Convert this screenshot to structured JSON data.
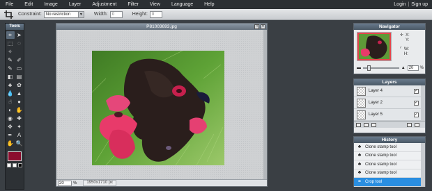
{
  "menubar": {
    "items": [
      "File",
      "Edit",
      "Image",
      "Layer",
      "Adjustment",
      "Filter",
      "View",
      "Language",
      "Help"
    ],
    "login": "Login",
    "separator": "|",
    "signup": "Sign up"
  },
  "options": {
    "constraint_label": "Constraint:",
    "constraint_value": "No restriction",
    "width_label": "Width:",
    "width_value": "0",
    "height_label": "Height:",
    "height_value": "0"
  },
  "tools": {
    "title": "Tools",
    "items": [
      {
        "icon": "crop-icon",
        "glyph": "⌗"
      },
      {
        "icon": "move-icon",
        "glyph": "➤"
      },
      {
        "icon": "marquee-icon",
        "glyph": "⬚"
      },
      {
        "icon": "lasso-icon",
        "glyph": "◌"
      },
      {
        "icon": "magic-wand-icon",
        "glyph": "✧"
      },
      {
        "icon": "blank-icon",
        "glyph": ""
      },
      {
        "icon": "pencil-icon",
        "glyph": "✎"
      },
      {
        "icon": "brush-icon",
        "glyph": "✐"
      },
      {
        "icon": "color-replace-icon",
        "glyph": "✎"
      },
      {
        "icon": "eraser-icon",
        "glyph": "▭"
      },
      {
        "icon": "bucket-icon",
        "glyph": "◧"
      },
      {
        "icon": "gradient-icon",
        "glyph": "▤"
      },
      {
        "icon": "clone-stamp-icon",
        "glyph": "♣"
      },
      {
        "icon": "pattern-icon",
        "glyph": "✿"
      },
      {
        "icon": "blur-icon",
        "glyph": "💧"
      },
      {
        "icon": "sharpen-icon",
        "glyph": "▲"
      },
      {
        "icon": "smudge-icon",
        "glyph": "☝"
      },
      {
        "icon": "sponge-icon",
        "glyph": "●"
      },
      {
        "icon": "dodge-icon",
        "glyph": "◐"
      },
      {
        "icon": "burn-icon",
        "glyph": "✋"
      },
      {
        "icon": "red-eye-icon",
        "glyph": "◉"
      },
      {
        "icon": "spot-heal-icon",
        "glyph": "✚"
      },
      {
        "icon": "bloat-icon",
        "glyph": "✥"
      },
      {
        "icon": "pinch-icon",
        "glyph": "✦"
      },
      {
        "icon": "color-picker-icon",
        "glyph": "✒"
      },
      {
        "icon": "type-icon",
        "glyph": "A"
      },
      {
        "icon": "hand-icon",
        "glyph": "✋"
      },
      {
        "icon": "zoom-icon",
        "glyph": "🔍"
      }
    ],
    "primary_color": "#8b0d2e",
    "secondary_colors": [
      "#ffffff",
      "#ffffff",
      "#000000"
    ]
  },
  "canvas": {
    "title": "P81003693.jpg",
    "zoom": "20",
    "zoom_unit": "%",
    "dimensions": "1950x1710 px"
  },
  "navigator": {
    "title": "Navigator",
    "x_label": "X:",
    "y_label": "Y:",
    "w_label": "W:",
    "h_label": "H:",
    "zoom": "20",
    "zoom_unit": "%",
    "zoom_fraction": 0.12
  },
  "layers": {
    "title": "Layers",
    "items": [
      {
        "name": "Layer 4",
        "checked": "✓"
      },
      {
        "name": "Layer 2",
        "checked": "✓"
      },
      {
        "name": "Layer 5",
        "checked": "✓"
      }
    ]
  },
  "history": {
    "title": "History",
    "items": [
      {
        "label": "Clone stamp tool",
        "active": false
      },
      {
        "label": "Clone stamp tool",
        "active": false
      },
      {
        "label": "Clone stamp tool",
        "active": false
      },
      {
        "label": "Clone stamp tool",
        "active": false
      },
      {
        "label": "Crop tool",
        "active": true
      }
    ]
  }
}
